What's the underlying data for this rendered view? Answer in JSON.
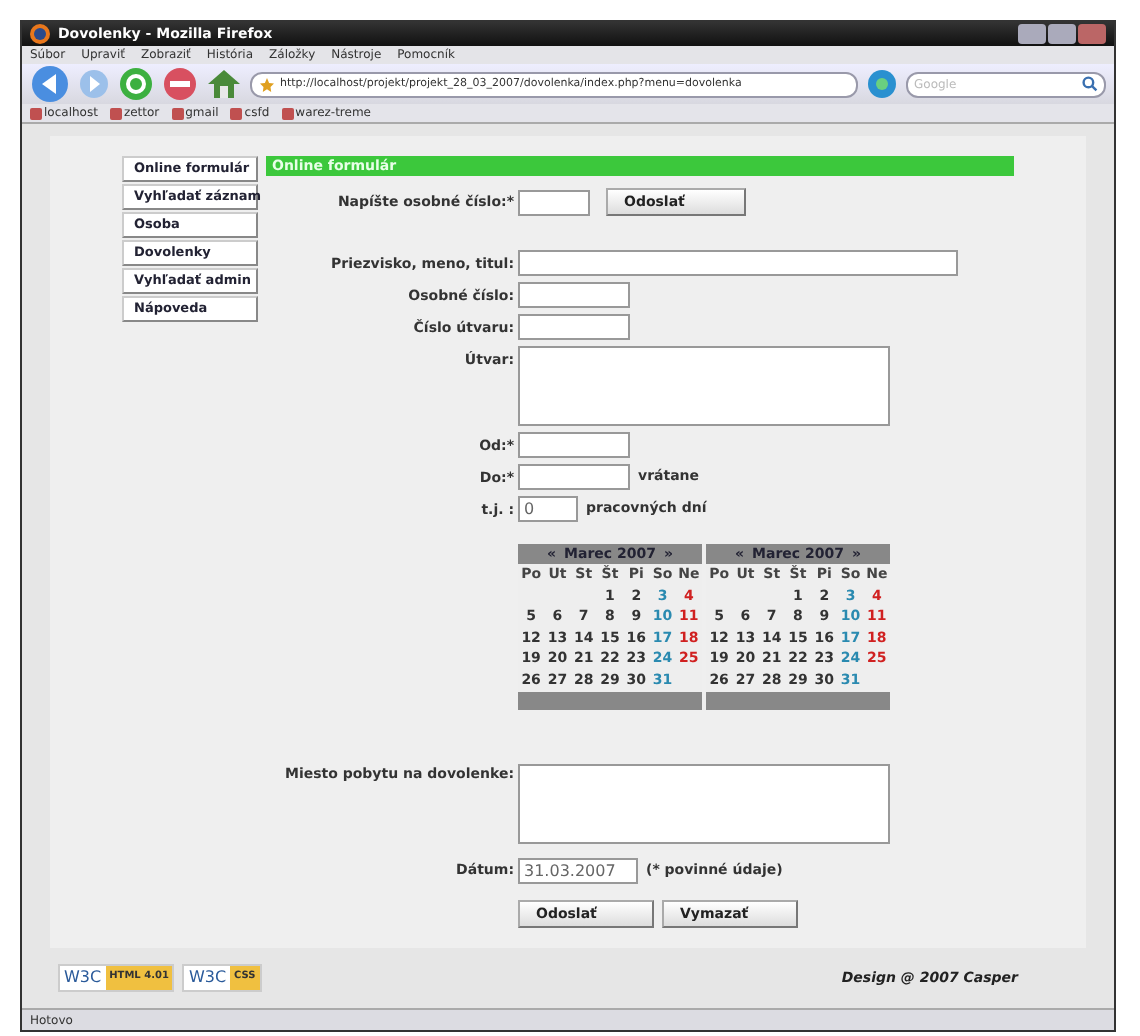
{
  "window": {
    "title": "Dovolenky - Mozilla Firefox"
  },
  "menu": [
    "Súbor",
    "Upraviť",
    "Zobraziť",
    "História",
    "Záložky",
    "Nástroje",
    "Pomocník"
  ],
  "address": {
    "value": "http://localhost/projekt/projekt_28_03_2007/dovolenka/index.php?menu=dovolenka"
  },
  "search": {
    "placeholder": "Google"
  },
  "bookmarks": [
    "localhost",
    "zettor",
    "gmail",
    "csfd",
    "warez-treme"
  ],
  "sidebar": {
    "items": [
      {
        "label": "Online formulár"
      },
      {
        "label": "Vyhľadať záznam"
      },
      {
        "label": "Osoba"
      },
      {
        "label": "Dovolenky"
      },
      {
        "label": "Vyhľadať admin"
      },
      {
        "label": "Nápoveda"
      }
    ]
  },
  "header": "Online formulár",
  "lookup": {
    "label": "Napíšte osobné číslo:",
    "required_mark": "*",
    "button": "Odoslať"
  },
  "fields": [
    {
      "kind": "longtext",
      "label": "Priezvisko, meno, titul:"
    },
    {
      "kind": "input",
      "label": "Osobné číslo:"
    },
    {
      "kind": "input",
      "label": "Číslo útvaru:"
    },
    {
      "kind": "textarea",
      "label": "Útvar:"
    },
    {
      "kind": "input",
      "label": "Od:",
      "required_mark": "*"
    },
    {
      "kind": "input",
      "label": "Do:",
      "required_mark": "*",
      "suffix": "vrátane"
    },
    {
      "kind": "number",
      "label": "t.j. :",
      "value": "0",
      "suffix": "pracovných dní"
    }
  ],
  "calendars": [
    {
      "prev": "«",
      "title": "Marec 2007",
      "next": "»",
      "weekdays": [
        "Po",
        "Ut",
        "St",
        "Št",
        "Pi",
        "So",
        "Ne"
      ],
      "weeks": [
        [
          "1",
          "2",
          "3",
          "4"
        ],
        [
          "5",
          "6",
          "7",
          "8",
          "9",
          "10",
          "11"
        ],
        [
          "12",
          "13",
          "14",
          "15",
          "16",
          "17",
          "18"
        ],
        [
          "19",
          "20",
          "21",
          "22",
          "23",
          "24",
          "25"
        ],
        [
          "26",
          "27",
          "28",
          "29",
          "30",
          "31"
        ]
      ]
    },
    {
      "prev": "«",
      "title": "Marec 2007",
      "next": "»",
      "weekdays": [
        "Po",
        "Ut",
        "St",
        "Št",
        "Pi",
        "So",
        "Ne"
      ],
      "weeks": [
        [
          "1",
          "2",
          "3",
          "4"
        ],
        [
          "5",
          "6",
          "7",
          "8",
          "9",
          "10",
          "11"
        ],
        [
          "12",
          "13",
          "14",
          "15",
          "16",
          "17",
          "18"
        ],
        [
          "19",
          "20",
          "21",
          "22",
          "23",
          "24",
          "25"
        ],
        [
          "26",
          "27",
          "28",
          "29",
          "30",
          "31"
        ]
      ]
    }
  ],
  "stay": {
    "label": "Miesto pobytu na dovolenke:"
  },
  "date": {
    "label": "Dátum:",
    "value": "31.03.2007",
    "note": "(* povinné údaje)"
  },
  "buttons": [
    "Odoslať",
    "Vymazať"
  ],
  "badges": [
    {
      "logo": "W3C",
      "text": "HTML 4.01"
    },
    {
      "logo": "W3C",
      "text": "CSS"
    }
  ],
  "footer": "Design @ 2007 Casper",
  "status_bar": "Hotovo"
}
